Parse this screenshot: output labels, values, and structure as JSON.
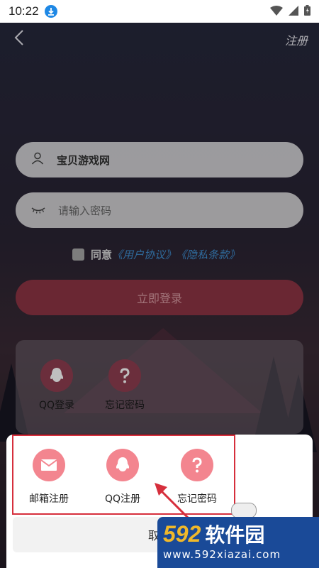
{
  "status_bar": {
    "time": "10:22"
  },
  "header": {
    "register_label": "注册"
  },
  "form": {
    "username_value": "宝贝游戏网",
    "password_placeholder": "请输入密码",
    "agree_label": "同意",
    "user_agreement_link": "《用户协议》",
    "privacy_link": "《隐私条款》",
    "login_button": "立即登录"
  },
  "login_options_panel": {
    "items": [
      {
        "label": "QQ登录",
        "icon": "qq-icon"
      },
      {
        "label": "忘记密码",
        "icon": "question-icon"
      }
    ]
  },
  "bottom_sheet": {
    "options": [
      {
        "label": "邮箱注册",
        "icon": "mail-icon"
      },
      {
        "label": "QQ注册",
        "icon": "qq-icon"
      },
      {
        "label": "忘记密码",
        "icon": "question-icon"
      }
    ],
    "cancel_label": "取消"
  },
  "watermark": {
    "brand_number": "592",
    "brand_text": "软件园",
    "url": "www.592xiazai.com"
  },
  "colors": {
    "accent_pink": "#f3858f",
    "login_button": "#8e3444",
    "link_blue": "#3f8fd2",
    "annotation_red": "#d62f3c",
    "watermark_blue": "#1a4a98"
  }
}
